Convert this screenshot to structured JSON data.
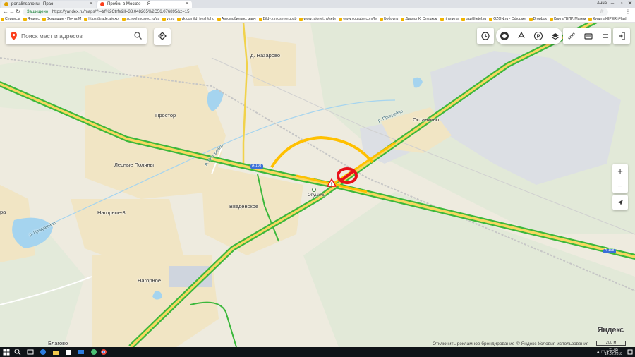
{
  "browser": {
    "tabs": [
      {
        "title": "portalinsano.ru · Прао",
        "active": false,
        "favicon_color": "#e0a000"
      },
      {
        "title": "Пробки в Москве — Я",
        "active": true,
        "favicon_color": "#fc3f1d"
      }
    ],
    "user_label": "Анна",
    "address": {
      "secure_label": "Защищено",
      "url": "https://yandex.ru/maps/?l=trf%2Ctrfe&ll=38.048265%2C56.076895&z=15"
    },
    "bookmarks": [
      "Сервисы",
      "Яндекс",
      "Входящие - Почта М",
      "https://trade.aliexpr",
      "school.mosreg.ru/us",
      "vk.ru",
      "vk.com/id_fresh/pho",
      "Автомобильно. запч",
      "Bildy.k.mosenergosb",
      "www.rajonet.ru/sebr",
      "www.youtube.com/fe",
      "Бобруль",
      "Диалог К. Следком",
      "rt плиты",
      "gaz@tetel.ru",
      "OZON.ru - Оформл",
      "Dropbox",
      "Книга \"ВПР. Матем",
      "Купить HIPER iFlash"
    ]
  },
  "search": {
    "placeholder": "Поиск мест и адресов"
  },
  "map": {
    "places": [
      {
        "name": "д. Назарово"
      },
      {
        "name": "Простор"
      },
      {
        "name": "Лесные Поляны"
      },
      {
        "name": "Нагорное-3"
      },
      {
        "name": "Введенское"
      },
      {
        "name": "Нагорное"
      },
      {
        "name": "Благово"
      },
      {
        "name": "Останкино"
      },
      {
        "name": "ра"
      }
    ],
    "rivers": [
      {
        "name": "р. Прохрейно"
      },
      {
        "name": "р. Прохрейно"
      },
      {
        "name": "р. Продавейно"
      }
    ],
    "road_badges": [
      "А-108",
      "А-108"
    ],
    "incident_label": "Опушечь",
    "colors": {
      "jam_green": "#3cb83c",
      "jam_yellow": "#ffc000",
      "closure_red": "#e8101a",
      "road_fill": "#f8d760",
      "forest": "#e3ead9",
      "village": "#f2e6c6"
    }
  },
  "controls": [
    "history-icon",
    "traffic-icon",
    "transit-icon",
    "parking-icon",
    "layers-icon",
    "ruler-icon",
    "print-icon",
    "menu-icon",
    "login-icon"
  ],
  "zoom": {
    "in": "+",
    "out": "−"
  },
  "brand": "Яндекс",
  "footer": {
    "disable_ad": "Отключить рекламное брендирование",
    "copyright": "© Яндекс ",
    "terms": "Условия использования",
    "scale": "200 м"
  },
  "taskbar": {
    "lang": "РУС",
    "time": "21:05",
    "date": "14.02.2018"
  }
}
